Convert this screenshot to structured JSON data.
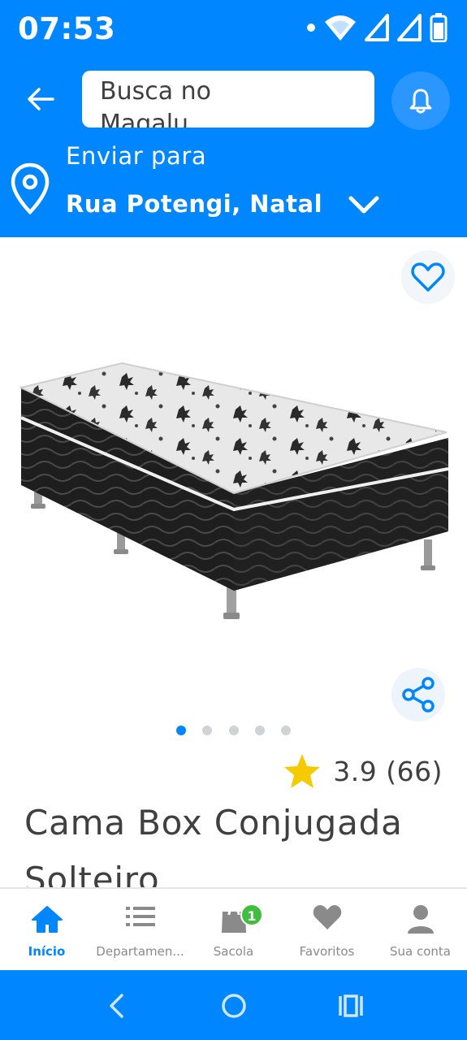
{
  "status_bar": {
    "time": "07:53"
  },
  "header": {
    "search_placeholder": "Busca no Magalu",
    "send_to_label": "Enviar para",
    "address": "Rua Potengi, Natal"
  },
  "gallery": {
    "total_images": 5,
    "active_index": 0
  },
  "product": {
    "rating_value": "3.9",
    "review_count": "(66)",
    "title": "Cama Box Conjugada Solteiro"
  },
  "bottom_nav": {
    "items": [
      {
        "label": "Início",
        "icon": "home-icon",
        "active": true
      },
      {
        "label": "Departamen...",
        "icon": "menu-list-icon",
        "active": false
      },
      {
        "label": "Sacola",
        "icon": "bag-icon",
        "active": false,
        "badge": "1"
      },
      {
        "label": "Favoritos",
        "icon": "heart-icon",
        "active": false
      },
      {
        "label": "Sua conta",
        "icon": "user-icon",
        "active": false
      }
    ]
  },
  "colors": {
    "brand_blue": "#0086ff",
    "badge_green": "#3fbe3f",
    "star_yellow": "#f5cb00",
    "text_dark": "#404040"
  }
}
